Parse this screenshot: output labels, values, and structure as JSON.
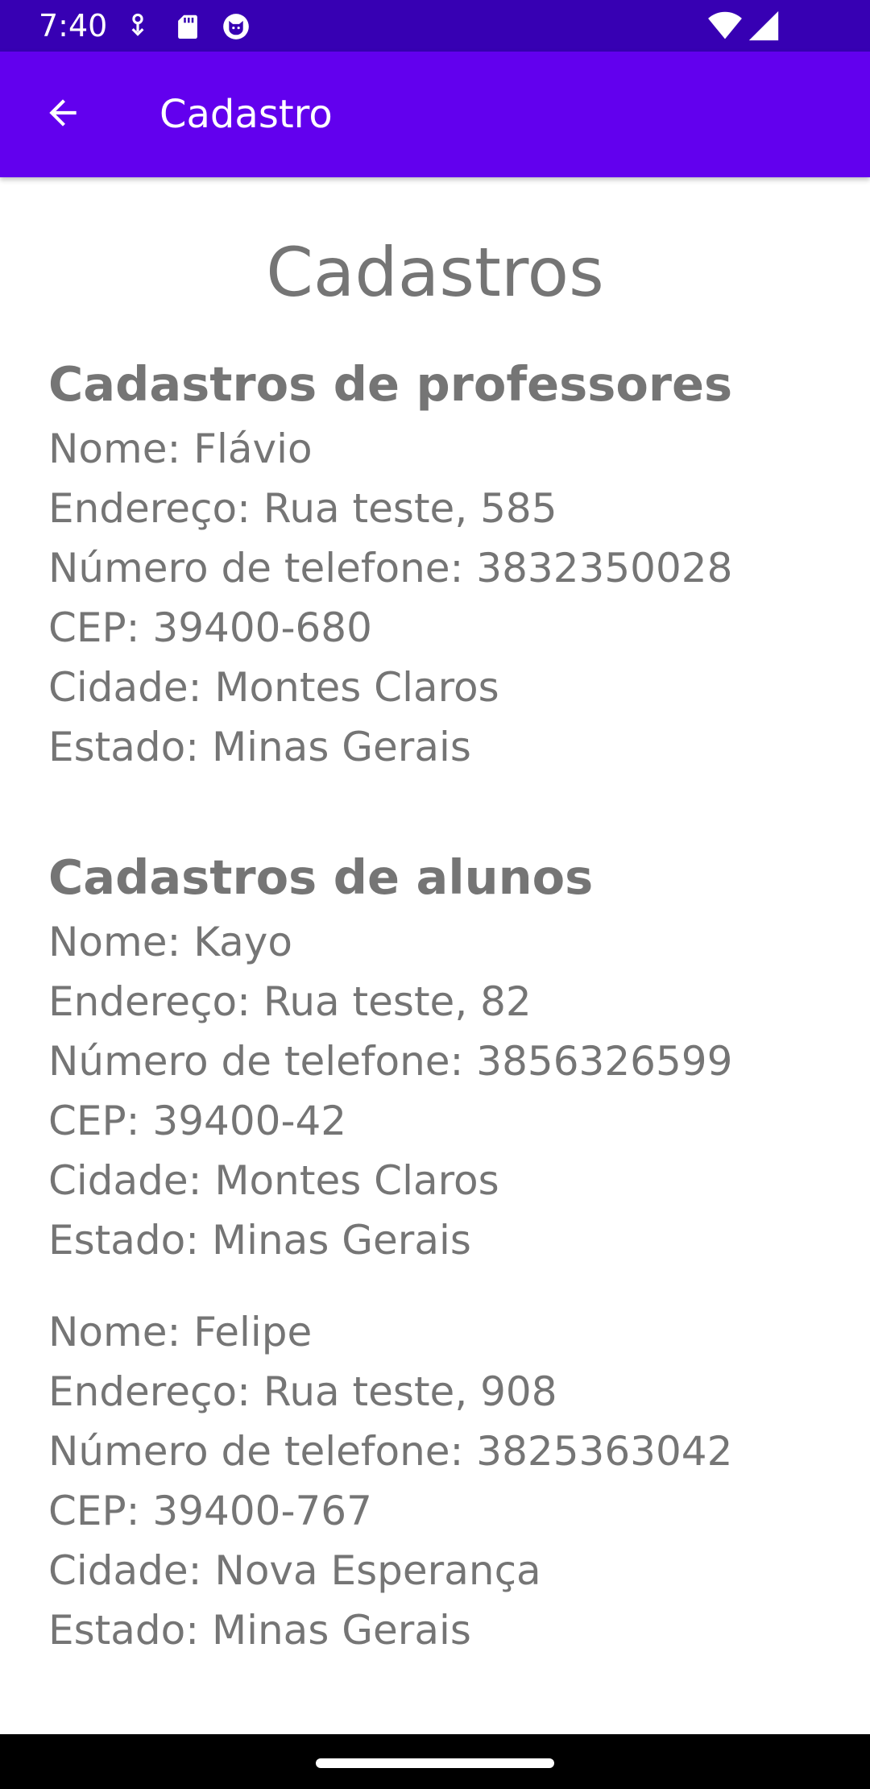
{
  "status_bar": {
    "time": "7:40",
    "left_icons": [
      "download-icon",
      "sd-card-icon",
      "cat-app-icon"
    ],
    "right_icons": [
      "wifi-icon",
      "cell-signal-icon"
    ]
  },
  "app_bar": {
    "title": "Cadastro",
    "back_icon": "arrow-back-icon",
    "color": "#6200ee",
    "status_color": "#3700b3"
  },
  "main": {
    "heading": "Cadastros",
    "professores": {
      "title": "Cadastros de professores",
      "records": [
        {
          "nome": "Nome: Flávio",
          "endereco": "Endereço: Rua teste, 585",
          "telefone": "Número de telefone: 3832350028",
          "cep": "CEP: 39400-680",
          "cidade": "Cidade: Montes Claros",
          "estado": "Estado: Minas Gerais"
        }
      ]
    },
    "alunos": {
      "title": "Cadastros de alunos",
      "records": [
        {
          "nome": "Nome: Kayo",
          "endereco": "Endereço: Rua teste, 82",
          "telefone": "Número de telefone: 3856326599",
          "cep": "CEP: 39400-42",
          "cidade": "Cidade: Montes Claros",
          "estado": "Estado: Minas Gerais"
        },
        {
          "nome": "Nome: Felipe",
          "endereco": "Endereço: Rua teste, 908",
          "telefone": "Número de telefone: 3825363042",
          "cep": "CEP: 39400-767",
          "cidade": "Cidade: Nova Esperança",
          "estado": "Estado: Minas Gerais"
        }
      ]
    }
  },
  "text_color": "#757575"
}
